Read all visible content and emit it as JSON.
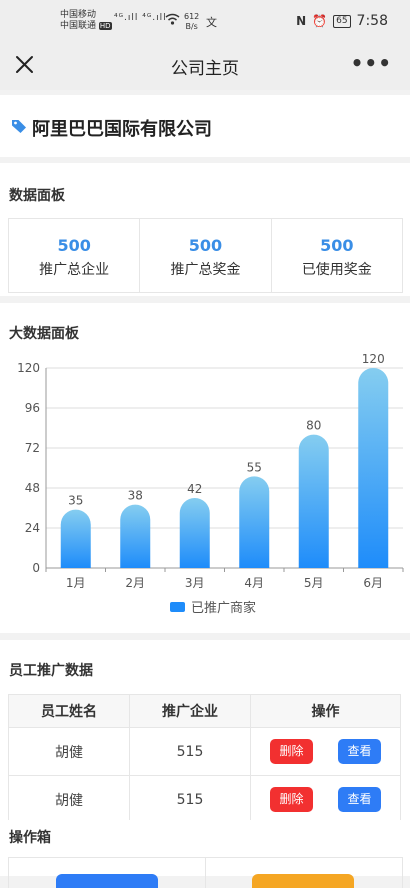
{
  "status_bar": {
    "carrier1": "中国移动",
    "carrier2": "中国联通",
    "hd": "HD",
    "signal": "⁴ᴳ.ıll ⁴ᴳ.ıll",
    "speed_value": "612",
    "speed_unit": "B/s",
    "battery": "65",
    "time": "7:58"
  },
  "nav": {
    "title": "公司主页",
    "more": "•••"
  },
  "company": {
    "name": "阿里巴巴国际有限公司"
  },
  "dashboard": {
    "title": "数据面板",
    "stats": [
      {
        "value": "500",
        "label": "推广总企业"
      },
      {
        "value": "500",
        "label": "推广总奖金"
      },
      {
        "value": "500",
        "label": "已使用奖金"
      }
    ]
  },
  "big_data": {
    "title": "大数据面板"
  },
  "chart_data": {
    "type": "bar",
    "categories": [
      "1月",
      "2月",
      "3月",
      "4月",
      "5月",
      "6月"
    ],
    "series": [
      {
        "name": "已推广商家",
        "values": [
          35,
          38,
          42,
          55,
          80,
          120
        ]
      }
    ],
    "ylim": [
      0,
      120
    ],
    "yticks": [
      0,
      24,
      48,
      72,
      96,
      120
    ],
    "grid": true,
    "legend_position": "bottom",
    "colors": {
      "bar_top": "#85cdf0",
      "bar_bottom": "#1e8cfa",
      "legend": "#1e8cfa"
    }
  },
  "staff": {
    "title": "员工推广数据",
    "headers": [
      "员工姓名",
      "推广企业",
      "操作"
    ],
    "rows": [
      {
        "name": "胡健",
        "count": "515",
        "delete": "删除",
        "view": "查看"
      },
      {
        "name": "胡健",
        "count": "515",
        "delete": "删除",
        "view": "查看"
      }
    ]
  },
  "toolbox": {
    "title": "操作箱"
  },
  "colors": {
    "accent": "#3a8ee6",
    "danger": "#f23030",
    "primary": "#2e7cf6",
    "warning": "#f5a623"
  }
}
